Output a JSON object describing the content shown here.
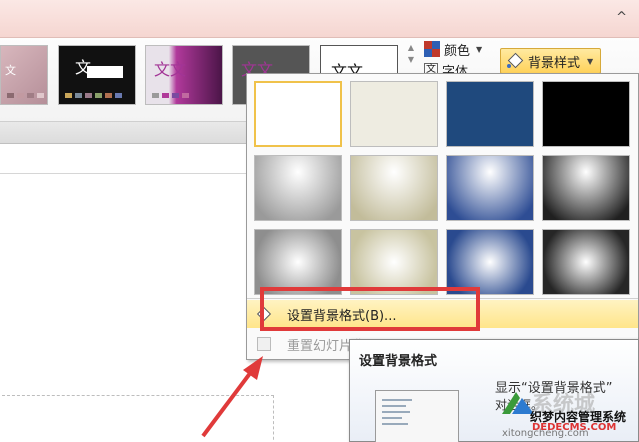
{
  "ribbon": {
    "help_glyph": "^",
    "themes": [
      {
        "name": "theme-1",
        "sample_text": "文"
      },
      {
        "name": "theme-2",
        "sample_text": "文"
      },
      {
        "name": "theme-3",
        "sample_text": "文文"
      },
      {
        "name": "theme-4",
        "sample_text": "文文"
      },
      {
        "name": "theme-5",
        "sample_text": "文文"
      }
    ],
    "colors_label": "颜色",
    "fonts_label": "字体",
    "background_style_label": "背景样式"
  },
  "gallery": {
    "tiles": [
      {
        "style": "solid",
        "color": "#ffffff",
        "selected": true
      },
      {
        "style": "solid",
        "color": "#eeece1"
      },
      {
        "style": "solid",
        "color": "#1f497d"
      },
      {
        "style": "solid",
        "color": "#000000"
      },
      {
        "style": "gradient",
        "color": "#9a9a9a"
      },
      {
        "style": "gradient",
        "color": "#c2bc9a"
      },
      {
        "style": "gradient",
        "color": "#2e4d94"
      },
      {
        "style": "gradient",
        "color": "#202020"
      },
      {
        "style": "radial",
        "color": "#8e8e8e"
      },
      {
        "style": "radial",
        "color": "#c8c3a0"
      },
      {
        "style": "radial",
        "color": "#2a4a8f"
      },
      {
        "style": "radial",
        "color": "#262626"
      }
    ],
    "format_background_label": "设置背景格式(B)...",
    "reset_background_label": "重置幻灯片背景(R)"
  },
  "tooltip": {
    "title": "设置背景格式",
    "description": "显示“设置背景格式”",
    "description_line2": "对话框。"
  },
  "watermark": {
    "line1": "系统城",
    "line2": "织梦内容管理系统",
    "line3": "DEDECMS.COM",
    "line4": "xitongcheng.com"
  },
  "colors": {
    "accent_yellow": "#ffd25a",
    "annotation_red": "#e03a3a"
  }
}
